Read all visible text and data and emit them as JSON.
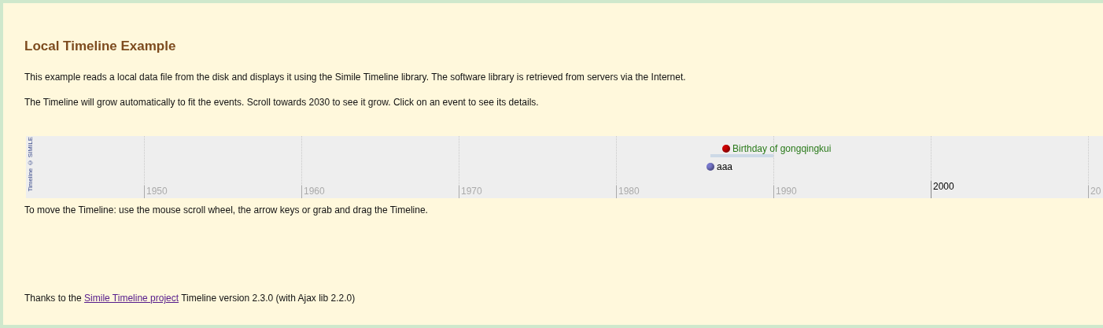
{
  "title": "Local Timeline Example",
  "paragraphs": [
    "This example reads a local data file from the disk and displays it using the Simile Timeline library. The software library is retrieved from servers via the Internet.",
    "The Timeline will grow automatically to fit the events. Scroll towards 2030 to see it grow. Click on an event to see its details."
  ],
  "timeline": {
    "credit": "Timeline © SIMILE",
    "ticks": [
      {
        "label": "1950",
        "kind": "minor"
      },
      {
        "label": "1960",
        "kind": "minor"
      },
      {
        "label": "1970",
        "kind": "minor"
      },
      {
        "label": "1980",
        "kind": "minor"
      },
      {
        "label": "1990",
        "kind": "minor"
      },
      {
        "label": "2000",
        "kind": "major"
      },
      {
        "label": "20",
        "kind": "minor"
      }
    ],
    "events": [
      {
        "label": "Birthday of gongqingkui",
        "color": "#cc0000",
        "kind": "duration"
      },
      {
        "label": "aaa",
        "color": "#7777cc",
        "kind": "instant"
      }
    ]
  },
  "help": "To move the Timeline: use the mouse scroll wheel, the arrow keys or grab and drag the Timeline.",
  "footer": {
    "before": "Thanks to the",
    "link": "Simile Timeline project",
    "after": "Timeline version 2.3.0 (with Ajax lib 2.2.0)"
  }
}
